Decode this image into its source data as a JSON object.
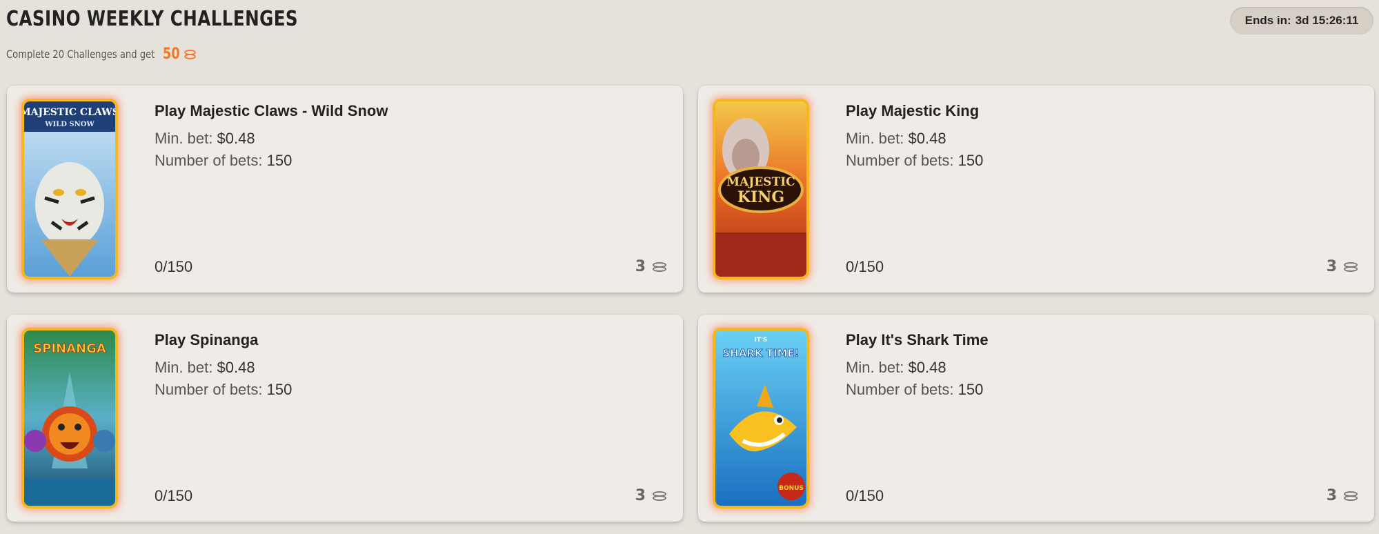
{
  "header": {
    "title": "CASINO WEEKLY CHALLENGES",
    "subtitle": "Complete 20 Challenges and get",
    "reward_amount": "50",
    "reward_icon": "coins-icon",
    "ends_label": "Ends in:",
    "ends_value": "3d 15:26:11"
  },
  "labels": {
    "min_bet": "Min. bet:",
    "num_bets": "Number of bets:"
  },
  "challenges": [
    {
      "title": "Play Majestic Claws - Wild Snow",
      "min_bet": "$0.48",
      "num_bets": "150",
      "progress": "0/150",
      "reward": "3",
      "thumb_logo_line1": "MAJESTIC CLAWS",
      "thumb_logo_line2": "WILD SNOW"
    },
    {
      "title": "Play Majestic King",
      "min_bet": "$0.48",
      "num_bets": "150",
      "progress": "0/150",
      "reward": "3",
      "thumb_logo_line1": "MAJESTIC",
      "thumb_logo_line2": "KING"
    },
    {
      "title": "Play Spinanga",
      "min_bet": "$0.48",
      "num_bets": "150",
      "progress": "0/150",
      "reward": "3",
      "thumb_logo_line1": "SPINANGA"
    },
    {
      "title": "Play It's Shark Time",
      "min_bet": "$0.48",
      "num_bets": "150",
      "progress": "0/150",
      "reward": "3",
      "thumb_logo_line1": "IT'S",
      "thumb_logo_line2": "SHARK TIME!",
      "thumb_badge": "BONUS"
    }
  ],
  "colors": {
    "accent": "#f07828",
    "thumb_border": "#f6b818",
    "background": "#e6e1db",
    "card": "#efebe6"
  }
}
